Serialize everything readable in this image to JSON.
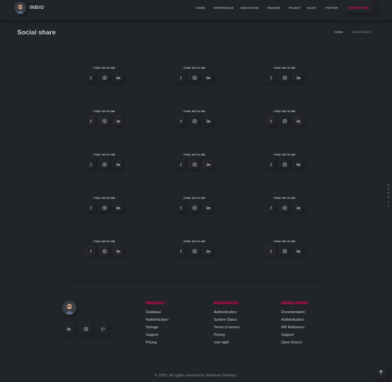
{
  "brand": {
    "name": "INBIO"
  },
  "nav": {
    "items": [
      {
        "label": "HOME"
      },
      {
        "label": "EXPERIENCE"
      },
      {
        "label": "EDUCATION"
      },
      {
        "label": "RESUME"
      },
      {
        "label": "PAGES"
      },
      {
        "label": "BLOG"
      },
      {
        "label": "FOOTER"
      }
    ],
    "contact_label": "CONTACT ME"
  },
  "page": {
    "title": "Social share",
    "breadcrumb": {
      "home": "Home",
      "current": "Social Share"
    }
  },
  "cards": {
    "title": "FIND WITH ME",
    "icons": [
      "facebook-icon",
      "instagram-icon",
      "linkedin-icon"
    ]
  },
  "footer": {
    "columns": [
      {
        "title": "PRODUCT",
        "links": [
          "Database",
          "Authentication",
          "Storage",
          "Support",
          "Pricing"
        ]
      },
      {
        "title": "RESOURCES",
        "links": [
          "Authentication",
          "System Status",
          "Terms of service",
          "Pricing",
          "over right"
        ]
      },
      {
        "title": "DEVELOPERS",
        "links": [
          "Documentation",
          "Authentication",
          "API Reference",
          "Support",
          "Open Source"
        ]
      }
    ],
    "social_icons": [
      "linkedin-icon",
      "instagram-icon",
      "twitter-icon"
    ],
    "copyright_prefix": "© 2022. All rights reserved by ",
    "copyright_link": "Rainbow-Themes."
  },
  "side_label": "SCROLL",
  "colors": {
    "accent": "#ff014f",
    "background": "#212428",
    "text": "#c4cfde"
  }
}
